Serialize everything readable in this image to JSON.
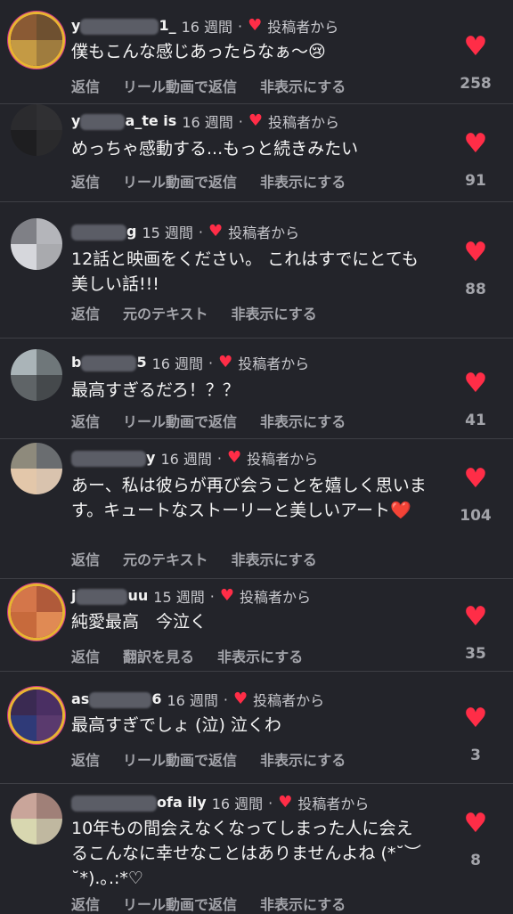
{
  "comments": [
    {
      "username_start": "y",
      "username_end": "1_",
      "time": "16 週間",
      "author_badge": "投稿者から",
      "text": "僕もこんな感じあったらなぁ〜😢",
      "actions": [
        "返信",
        "リール動画で返信",
        "非表示にする"
      ],
      "likes": "258",
      "avatar_colors": [
        "#8a5a34",
        "#6e5030",
        "#c49a44",
        "#9f7c3e"
      ],
      "story": true
    },
    {
      "username_start": "y",
      "username_end": "a_te  is",
      "time": "16 週間",
      "author_badge": "投稿者から",
      "text": "めっちゃ感動する...もっと続きみたい",
      "actions": [
        "返信",
        "リール動画で返信",
        "非表示にする"
      ],
      "likes": "91",
      "avatar_colors": [
        "#2b2b2e",
        "#303033",
        "#1e1e20",
        "#2a2a2c"
      ],
      "story": false
    },
    {
      "username_start": "",
      "username_end": "g",
      "time": "15 週間",
      "author_badge": "投稿者から",
      "text": "12話と映画をください。 これはすでにとても美しい話!!!",
      "actions": [
        "返信",
        "元のテキスト",
        "非表示にする"
      ],
      "likes": "88",
      "avatar_colors": [
        "#7f8086",
        "#b4b5ba",
        "#d6d7dc",
        "#a9aaae"
      ],
      "story": false
    },
    {
      "username_start": "b",
      "username_end": "5",
      "time": "16 週間",
      "author_badge": "投稿者から",
      "text": "最高すぎるだろ！？？",
      "actions": [
        "返信",
        "リール動画で返信",
        "非表示にする"
      ],
      "likes": "41",
      "avatar_colors": [
        "#aab4b8",
        "#6f777a",
        "#5f6467",
        "#45494c"
      ],
      "story": false
    },
    {
      "username_start": "",
      "username_end": "y",
      "time": "16 週間",
      "author_badge": "投稿者から",
      "text": "あー、私は彼らが再び会うことを嬉しく思います。キュートなストーリーと美しいアート❤️",
      "actions": [
        "返信",
        "元のテキスト",
        "非表示にする"
      ],
      "likes": "104",
      "avatar_colors": [
        "#8e8a7c",
        "#6a6d70",
        "#e3c7aa",
        "#d9c3ae"
      ],
      "story": false
    },
    {
      "username_start": "j",
      "username_end": "uu",
      "time": "15 週間",
      "author_badge": "投稿者から",
      "text": "純愛最高　今泣く",
      "actions": [
        "返信",
        "翻訳を見る",
        "非表示にする"
      ],
      "likes": "35",
      "avatar_colors": [
        "#d4764a",
        "#b05a3a",
        "#c76a3c",
        "#e08a54"
      ],
      "story": true
    },
    {
      "username_start": "as",
      "username_end": "6",
      "time": "16 週間",
      "author_badge": "投稿者から",
      "text": "最高すぎでしょ (泣) 泣くわ",
      "actions": [
        "返信",
        "リール動画で返信",
        "非表示にする"
      ],
      "likes": "3",
      "avatar_colors": [
        "#3a2a52",
        "#4a2f63",
        "#2f3a78",
        "#5a3a6e"
      ],
      "story": true
    },
    {
      "username_start": "",
      "username_end": "ofa  ily",
      "time": "16 週間",
      "author_badge": "投稿者から",
      "text": "10年もの間会えなくなってしまった人に会えるこんなに幸せなことはありませんよね (*˘︶˘*).｡.:*♡",
      "actions": [
        "返信",
        "リール動画で返信",
        "非表示にする"
      ],
      "likes": "8",
      "avatar_colors": [
        "#c9a59a",
        "#a08078",
        "#d8d7b0",
        "#c0b8a0"
      ],
      "story": false
    }
  ]
}
